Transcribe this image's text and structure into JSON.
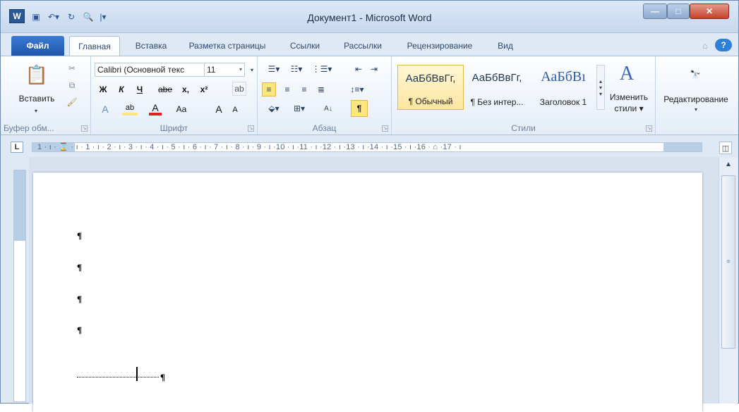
{
  "window": {
    "title": "Документ1 - Microsoft Word"
  },
  "qat": {
    "logo": "W",
    "icons": [
      "save-icon",
      "undo-icon",
      "redo-icon",
      "print-preview-icon",
      "customize-qat-icon"
    ]
  },
  "tabs": [
    "Файл",
    "Главная",
    "Вставка",
    "Разметка страницы",
    "Ссылки",
    "Рассылки",
    "Рецензирование",
    "Вид"
  ],
  "clipboard": {
    "paste": "Вставить",
    "label": "Буфер обм..."
  },
  "font": {
    "name": "Calibri (Основной текс",
    "size": "11",
    "label": "Шрифт",
    "bold": "Ж",
    "italic": "К",
    "underline": "Ч",
    "strike": "abe",
    "sub": "x,",
    "sup": "x²",
    "case": "Aa",
    "grow": "A",
    "shrink": "A"
  },
  "paragraph": {
    "label": "Абзац",
    "sort": "A↓",
    "pilcrow": "¶"
  },
  "styles": {
    "label": "Стили",
    "items": [
      {
        "sample": "АаБбВвГг,",
        "name": "¶ Обычный"
      },
      {
        "sample": "АаБбВвГг,",
        "name": "¶ Без интер..."
      },
      {
        "sample": "АаБбВı",
        "name": "Заголовок 1"
      }
    ],
    "change_line1": "Изменить",
    "change_line2": "стили ▾"
  },
  "editing": {
    "label": "Редактирование"
  },
  "ruler": {
    "tab_selector": "L",
    "text": "1 · ı · ⌛ · ı · 1 · ı · 2 · ı · 3 · ı · 4 · ı · 5 · ı · 6 · ı · 7 · ı · 8 · ı · 9 · ı ·10 · ı ·11 · ı ·12 · ı ·13 · ı ·14 · ı ·15 · ı ·16 · ⌂ ·17 · ı"
  },
  "document": {
    "pilcrow": "¶"
  },
  "colors": {
    "accent": "#2b5797",
    "file_tab": "#1e56ab",
    "highlight": "#fde67b",
    "font_red": "#e02020"
  }
}
